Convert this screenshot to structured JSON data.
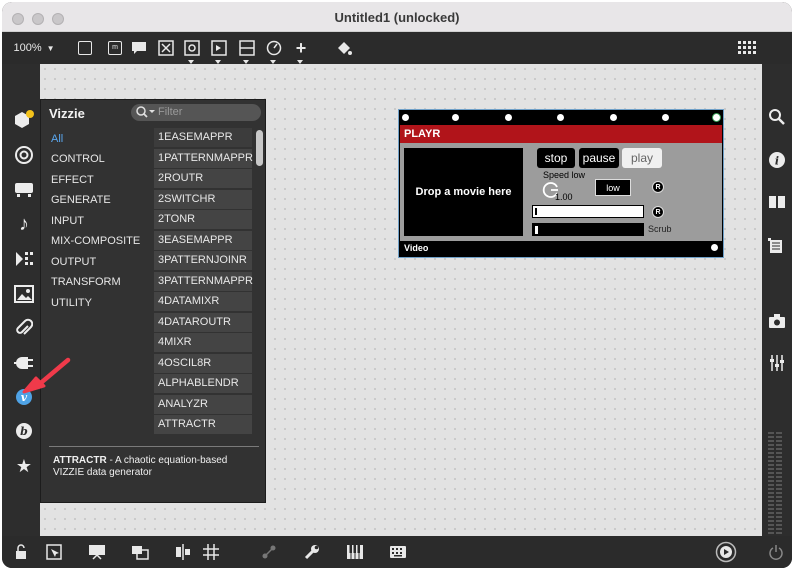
{
  "window": {
    "title": "Untitled1 (unlocked)"
  },
  "toolbar": {
    "zoom": "100%"
  },
  "vizzie": {
    "title": "Vizzie",
    "filter_placeholder": "Filter",
    "categories": [
      "All",
      "CONTROL",
      "EFFECT",
      "GENERATE",
      "INPUT",
      "MIX-COMPOSITE",
      "OUTPUT",
      "TRANSFORM",
      "UTILITY"
    ],
    "selected_category": "All",
    "items": [
      "1EASEMAPPR",
      "1PATTERNMAPPR",
      "2ROUTR",
      "2SWITCHR",
      "2TONR",
      "3EASEMAPPR",
      "3PATTERNJOINR",
      "3PATTERNMAPPR",
      "4DATAMIXR",
      "4DATAROUTR",
      "4MIXR",
      "4OSCIL8R",
      "ALPHABLENDR",
      "ANALYZR",
      "ATTRACTR"
    ],
    "description_name": "ATTRACTR",
    "description_text": " - A chaotic equation-based VIZZIE data generator"
  },
  "module": {
    "name": "PLAYR",
    "drop_text": "Drop a movie here",
    "stop": "stop",
    "pause": "pause",
    "play": "play",
    "speed_label": "Speed low",
    "speed_value": "1.00",
    "low_button": "low",
    "reset": "R",
    "scrub_label": "Scrub",
    "output_label": "Video"
  },
  "colors": {
    "module_header": "#b1141a",
    "selected_category": "#5aa8f0",
    "annotation_arrow": "#f03a4a"
  }
}
